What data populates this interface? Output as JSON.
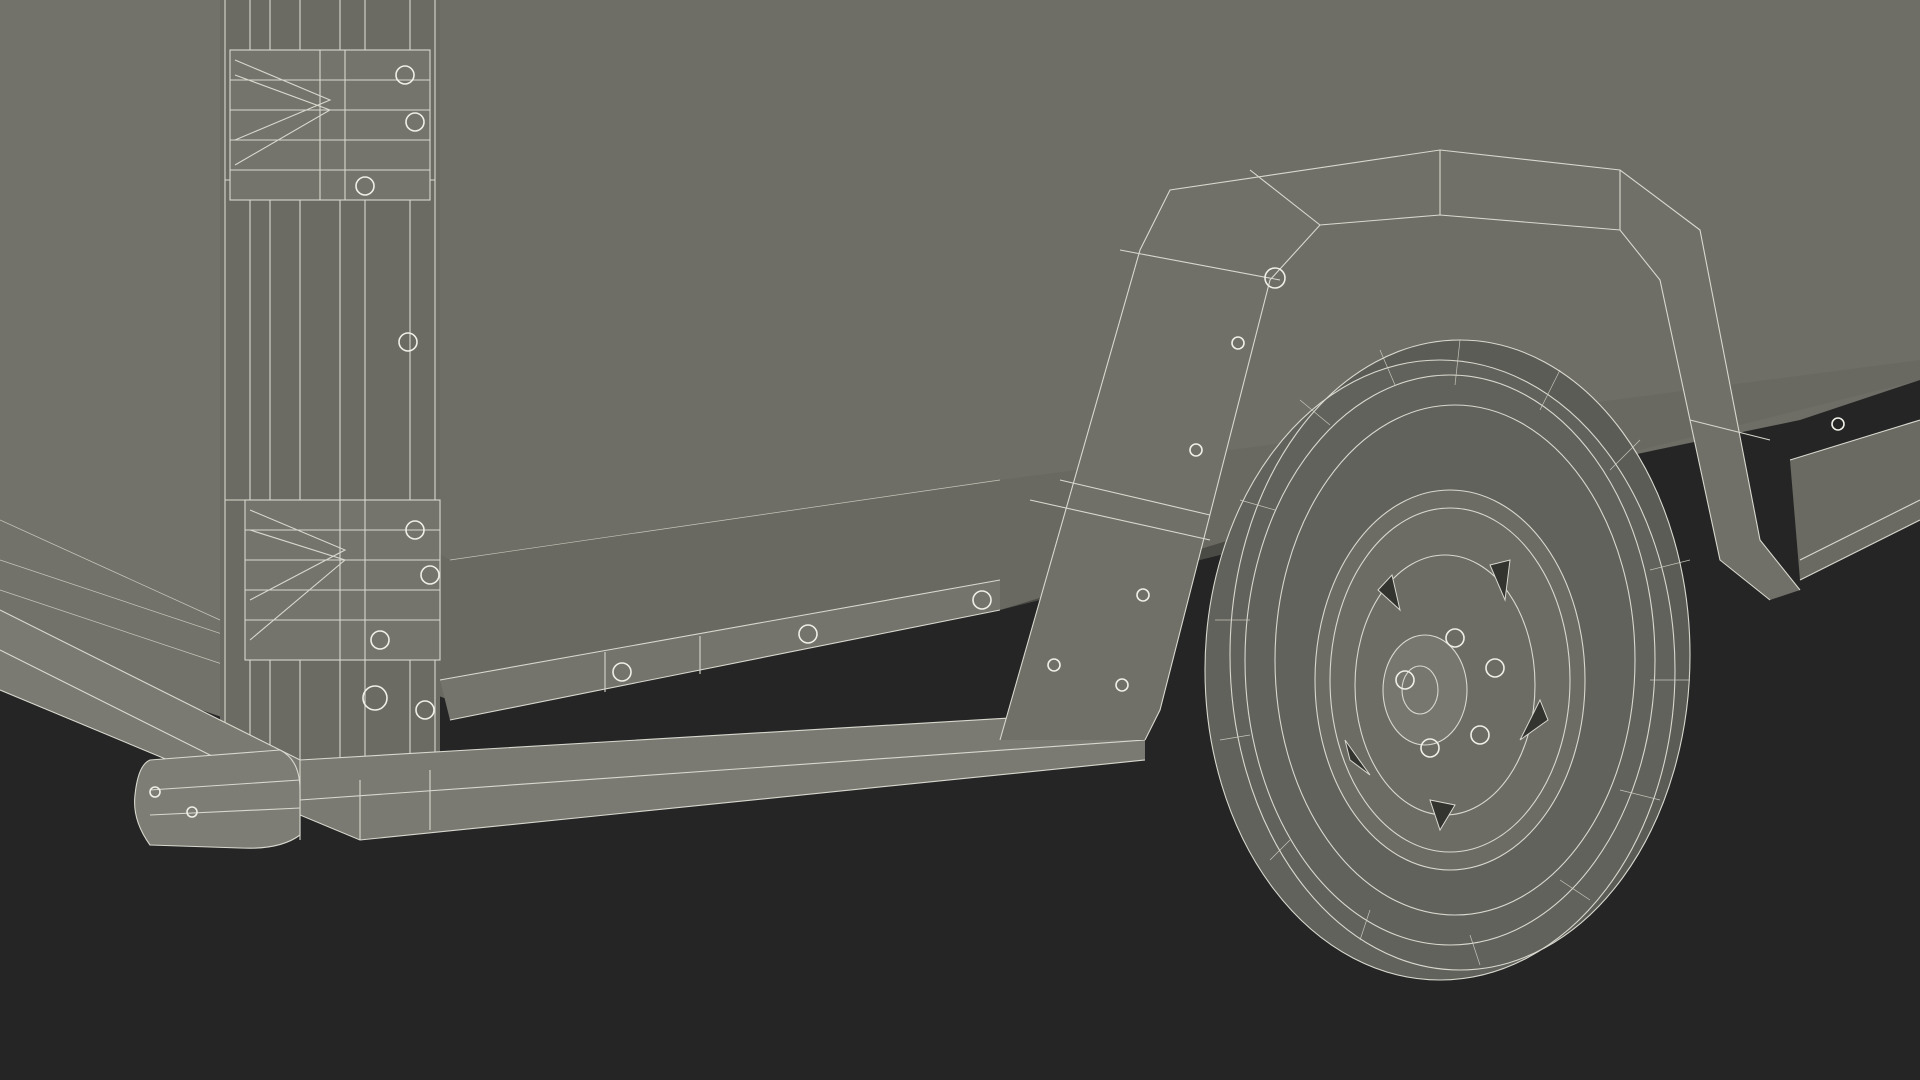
{
  "scene": {
    "subject": "trailer-wireframe-render",
    "colors": {
      "background": "#252525",
      "panel": "#6e6e66",
      "panel_dark": "#5e5e57",
      "wire": "#d8d8cf",
      "tire": "#5a5a54"
    }
  },
  "objects": {
    "wheel": {
      "spokes": 5,
      "lug_nuts": 5
    }
  }
}
